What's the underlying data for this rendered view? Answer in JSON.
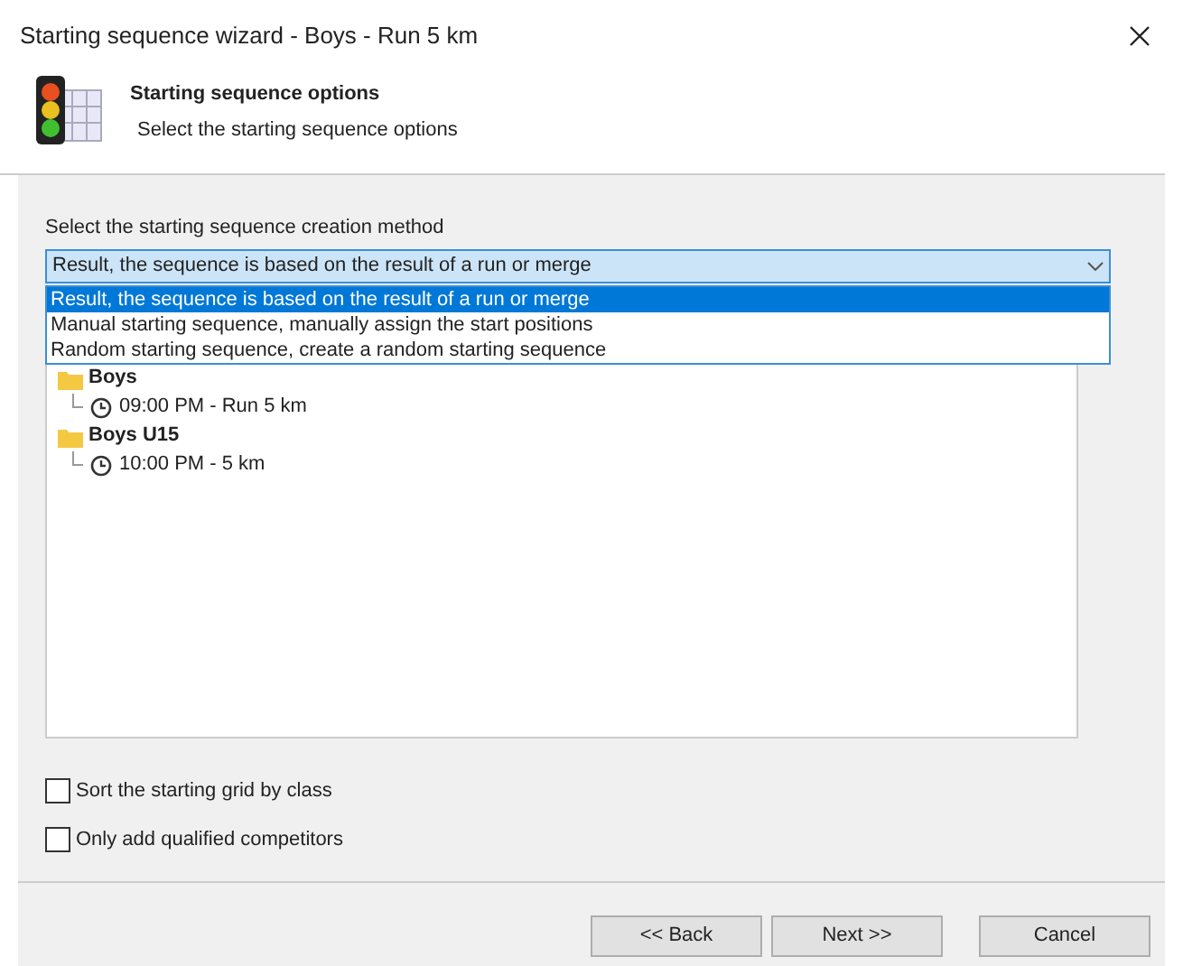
{
  "window": {
    "title": "Starting sequence wizard - Boys - Run 5 km"
  },
  "header": {
    "title": "Starting sequence options",
    "subtitle": "Select the starting sequence options"
  },
  "method": {
    "label": "Select the starting sequence creation method",
    "value": "Result, the sequence is based on the result of a run or merge",
    "expanded": true,
    "options": [
      {
        "label": "Result, the sequence is based on the result of a run or merge",
        "selected": true
      },
      {
        "label": "Manual starting sequence, manually assign the start positions",
        "selected": false
      },
      {
        "label": "Random starting sequence, create a random starting sequence",
        "selected": false
      }
    ]
  },
  "tree": [
    {
      "label": "Boys",
      "children": [
        {
          "label": "09:00 PM - Run 5 km"
        }
      ]
    },
    {
      "label": "Boys U15",
      "children": [
        {
          "label": "10:00 PM - 5 km"
        }
      ]
    }
  ],
  "options": [
    {
      "label": "Sort the starting grid by class",
      "checked": false
    },
    {
      "label": "Only add qualified competitors",
      "checked": false
    }
  ],
  "buttons": [
    {
      "label": "<< Back"
    },
    {
      "label": "Next >>"
    },
    {
      "label": "Cancel"
    }
  ]
}
